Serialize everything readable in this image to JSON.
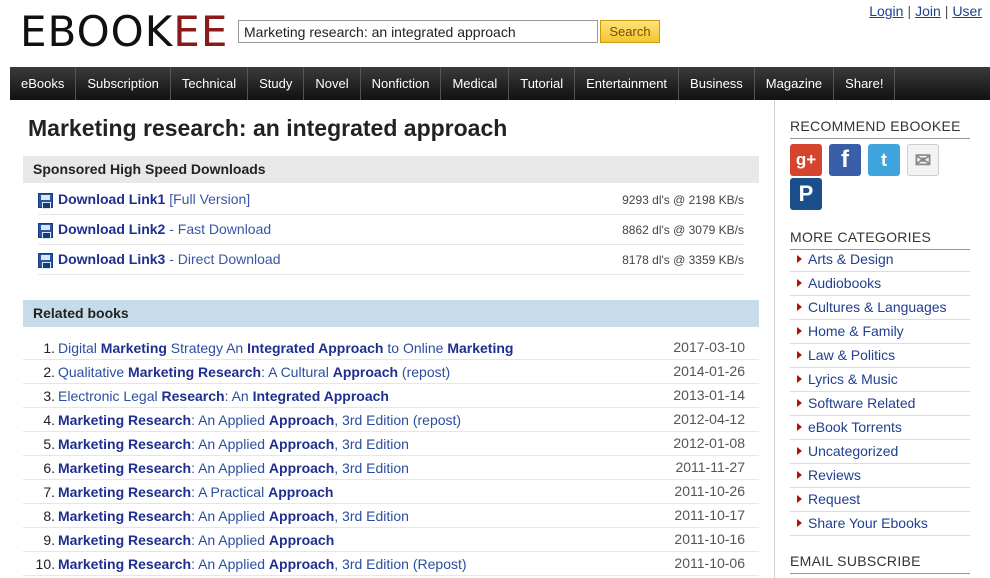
{
  "header": {
    "logo_dark": "EBOOK",
    "logo_red": "EE",
    "search_value": "Marketing research: an integrated approach",
    "search_button": "Search",
    "login": "Login",
    "join": "Join",
    "user": "User",
    "separator": "|"
  },
  "nav": [
    "eBooks",
    "Subscription",
    "Technical",
    "Study",
    "Novel",
    "Nonfiction",
    "Medical",
    "Tutorial",
    "Entertainment",
    "Business",
    "Magazine",
    "Share!"
  ],
  "main": {
    "title": "Marketing research: an integrated approach",
    "sponsored_heading": "Sponsored High Speed Downloads",
    "downloads": [
      {
        "label": "Download Link1",
        "sub": " [Full Version]",
        "stats": "9293 dl's @ 2198 KB/s"
      },
      {
        "label": "Download Link2",
        "sub": " - Fast Download",
        "stats": "8862 dl's @ 3079 KB/s"
      },
      {
        "label": "Download Link3",
        "sub": " - Direct Download",
        "stats": "8178 dl's @ 3359 KB/s"
      }
    ],
    "related_heading": "Related books",
    "books": [
      {
        "num": "1.",
        "html": "Digital <b>Marketing</b> Strategy An <b>Integrated Approach</b> to Online <b>Marketing</b>",
        "date": "2017-03-10"
      },
      {
        "num": "2.",
        "html": "Qualitative <b>Marketing Research</b>: A Cultural <b>Approach</b> (repost)",
        "date": "2014-01-26"
      },
      {
        "num": "3.",
        "html": "Electronic Legal <b>Research</b>: An <b>Integrated Approach</b>",
        "date": "2013-01-14"
      },
      {
        "num": "4.",
        "html": "<b>Marketing Research</b>: An Applied <b>Approach</b>, 3rd Edition (repost)",
        "date": "2012-04-12"
      },
      {
        "num": "5.",
        "html": "<b>Marketing Research</b>: An Applied <b>Approach</b>, 3rd Edition",
        "date": "2012-01-08"
      },
      {
        "num": "6.",
        "html": "<b>Marketing Research</b>: An Applied <b>Approach</b>, 3rd Edition",
        "date": "2011-11-27"
      },
      {
        "num": "7.",
        "html": "<b>Marketing Research</b>: A Practical <b>Approach</b>",
        "date": "2011-10-26"
      },
      {
        "num": "8.",
        "html": "<b>Marketing Research</b>: An Applied <b>Approach</b>, 3rd Edition",
        "date": "2011-10-17"
      },
      {
        "num": "9.",
        "html": "<b>Marketing Research</b>: An Applied <b>Approach</b>",
        "date": "2011-10-16"
      },
      {
        "num": "10.",
        "html": "<b>Marketing Research</b>: An Applied <b>Approach</b>, 3rd Edition (Repost)",
        "date": "2011-10-06"
      }
    ]
  },
  "sidebar": {
    "recommend_heading": "RECOMMEND EBOOKEE",
    "social": [
      {
        "name": "google-plus-icon",
        "glyph": "g+"
      },
      {
        "name": "facebook-icon",
        "glyph": "f"
      },
      {
        "name": "twitter-icon",
        "glyph": "t"
      },
      {
        "name": "email-icon",
        "glyph": "✉"
      },
      {
        "name": "pinterest-icon",
        "glyph": "P"
      }
    ],
    "categories_heading": "MORE CATEGORIES",
    "categories": [
      "Arts & Design",
      "Audiobooks",
      "Cultures & Languages",
      "Home & Family",
      "Law & Politics",
      "Lyrics & Music",
      "Software Related",
      "eBook Torrents",
      "Uncategorized",
      "Reviews",
      "Request",
      "Share Your Ebooks"
    ],
    "subscribe_heading": "EMAIL SUBSCRIBE"
  },
  "colors": {
    "nav_bg": "#1a1a1a",
    "logo_red": "#8a1a1a",
    "link_blue": "#1f2f8f",
    "search_btn": "#f6c52e",
    "related_bg": "#c6dcea"
  }
}
